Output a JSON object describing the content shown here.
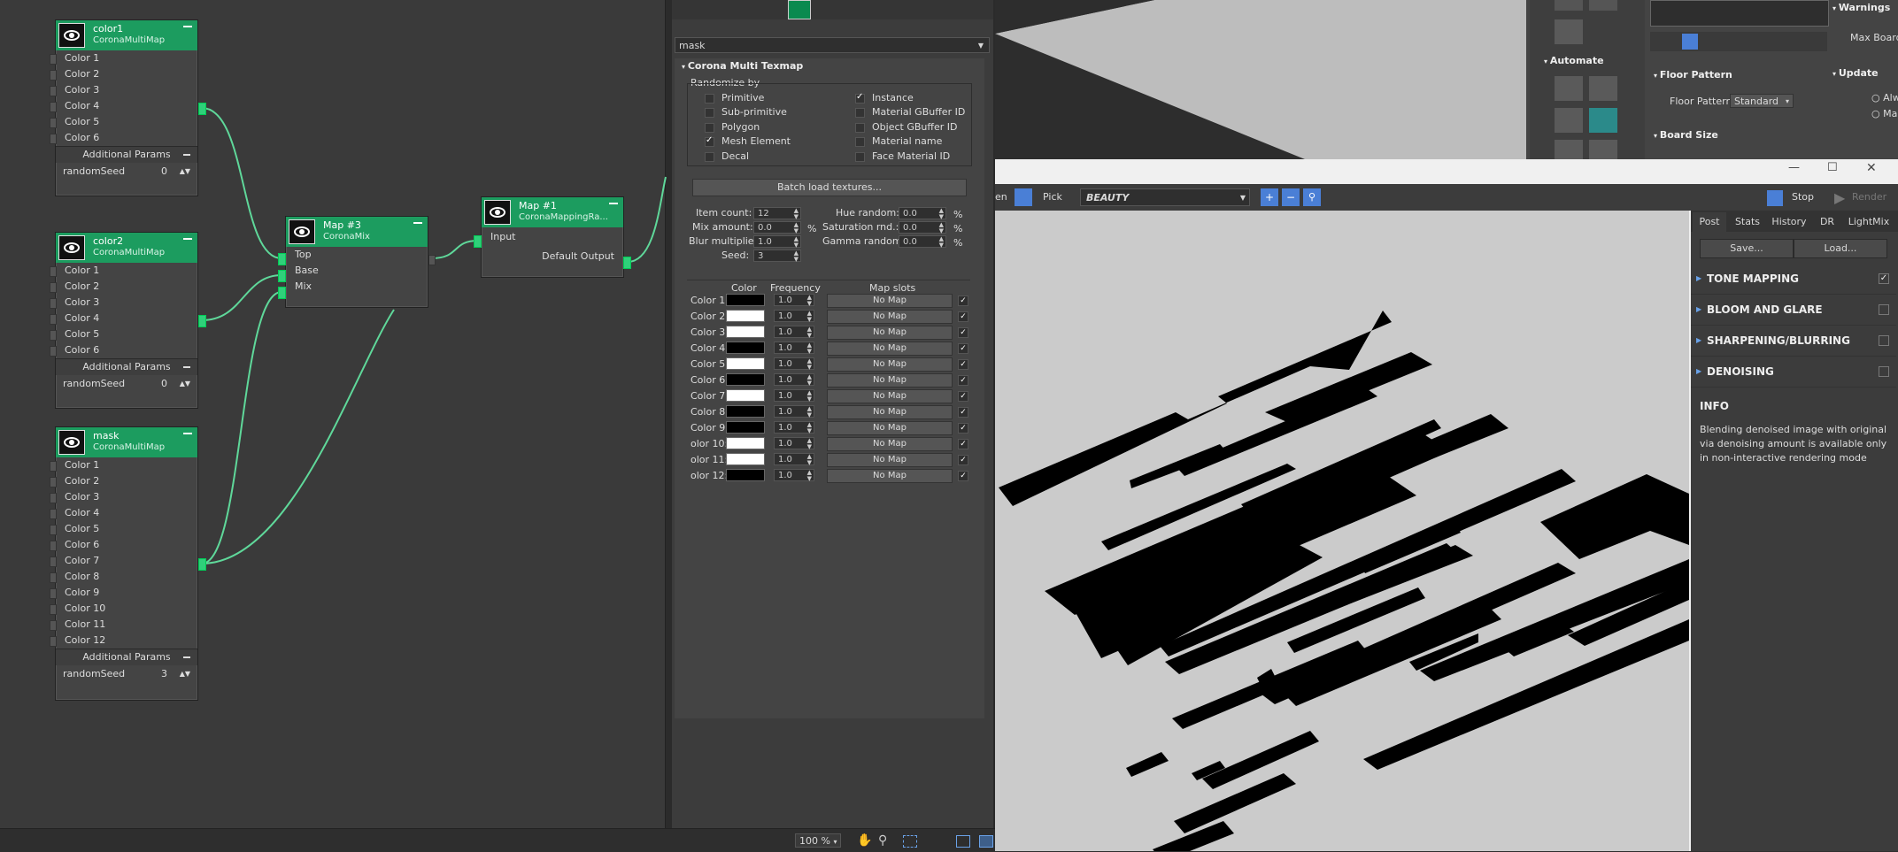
{
  "nodes": {
    "color1": {
      "name": "color1",
      "type": "CoronaMultiMap",
      "slots": [
        "Color 1",
        "Color 2",
        "Color 3",
        "Color 4",
        "Color 5",
        "Color 6"
      ],
      "section": "Additional Params",
      "seed_label": "randomSeed",
      "seed_value": "0"
    },
    "color2": {
      "name": "color2",
      "type": "CoronaMultiMap",
      "slots": [
        "Color 1",
        "Color 2",
        "Color 3",
        "Color 4",
        "Color 5",
        "Color 6"
      ],
      "section": "Additional Params",
      "seed_label": "randomSeed",
      "seed_value": "0"
    },
    "mask": {
      "name": "mask",
      "type": "CoronaMultiMap",
      "slots": [
        "Color 1",
        "Color 2",
        "Color 3",
        "Color 4",
        "Color 5",
        "Color 6",
        "Color 7",
        "Color 8",
        "Color 9",
        "Color 10",
        "Color 11",
        "Color 12"
      ],
      "section": "Additional Params",
      "seed_label": "randomSeed",
      "seed_value": "3"
    },
    "map3": {
      "name": "Map #3",
      "type": "CoronaMix",
      "inputs": [
        "Top",
        "Base",
        "Mix"
      ]
    },
    "map1": {
      "name": "Map #1",
      "type": "CoronaMappingRa...",
      "input": "Input",
      "output": "Default Output"
    }
  },
  "slate_status": {
    "zoom": "100 %"
  },
  "params": {
    "map_name": "mask",
    "rollout_title": "Corona Multi Texmap",
    "randomize_label": "Randomize by",
    "randomize_left": [
      {
        "label": "Primitive",
        "on": false
      },
      {
        "label": "Sub-primitive",
        "on": false
      },
      {
        "label": "Polygon",
        "on": false
      },
      {
        "label": "Mesh Element",
        "on": true
      },
      {
        "label": "Decal",
        "on": false
      }
    ],
    "randomize_right": [
      {
        "label": "Instance",
        "on": true
      },
      {
        "label": "Material GBuffer ID",
        "on": false
      },
      {
        "label": "Object GBuffer ID",
        "on": false
      },
      {
        "label": "Material name",
        "on": false
      },
      {
        "label": "Face Material ID",
        "on": false
      }
    ],
    "batch_button": "Batch load textures...",
    "item_count_label": "Item count:",
    "item_count": "12",
    "mix_amount_label": "Mix amount:",
    "mix_amount": "0.0",
    "mix_unit": "%",
    "blur_label": "Blur multiplier:",
    "blur": "1.0",
    "seed_label": "Seed:",
    "seed": "3",
    "hue_label": "Hue random:",
    "hue": "0.0",
    "hue_unit": "%",
    "sat_label": "Saturation rnd.:",
    "sat": "0.0",
    "sat_unit": "%",
    "gamma_label": "Gamma random:",
    "gamma": "0.0",
    "gamma_unit": "%",
    "col_header_color": "Color",
    "col_header_freq": "Frequency",
    "col_header_slots": "Map slots",
    "rows": [
      {
        "label": "Color 1:",
        "color": "#000000",
        "freq": "1.0",
        "map": "No Map"
      },
      {
        "label": "Color 2:",
        "color": "#ffffff",
        "freq": "1.0",
        "map": "No Map"
      },
      {
        "label": "Color 3:",
        "color": "#ffffff",
        "freq": "1.0",
        "map": "No Map"
      },
      {
        "label": "Color 4:",
        "color": "#000000",
        "freq": "1.0",
        "map": "No Map"
      },
      {
        "label": "Color 5:",
        "color": "#ffffff",
        "freq": "1.0",
        "map": "No Map"
      },
      {
        "label": "Color 6:",
        "color": "#000000",
        "freq": "1.0",
        "map": "No Map"
      },
      {
        "label": "Color 7:",
        "color": "#ffffff",
        "freq": "1.0",
        "map": "No Map"
      },
      {
        "label": "Color 8:",
        "color": "#000000",
        "freq": "1.0",
        "map": "No Map"
      },
      {
        "label": "Color 9:",
        "color": "#000000",
        "freq": "1.0",
        "map": "No Map"
      },
      {
        "label": "olor 10:",
        "color": "#ffffff",
        "freq": "1.0",
        "map": "No Map"
      },
      {
        "label": "olor 11:",
        "color": "#ffffff",
        "freq": "1.0",
        "map": "No Map"
      },
      {
        "label": "olor 12:",
        "color": "#000000",
        "freq": "1.0",
        "map": "No Map"
      }
    ]
  },
  "cmd_panel": {
    "automate": "Automate",
    "warnings": "Warnings",
    "max_boards": "Max Boards",
    "floor_pattern_title": "Floor Pattern",
    "floor_pattern_label": "Floor Pattern",
    "floor_pattern_value": "Standard",
    "board_size": "Board Size",
    "update": "Update",
    "update_opt1": "Alw",
    "update_opt2": "Ma"
  },
  "vfb": {
    "left_fragment": "en",
    "pick": "Pick",
    "channel": "BEAUTY",
    "stop": "Stop",
    "render": "Render",
    "tabs": [
      "Post",
      "Stats",
      "History",
      "DR",
      "LightMix"
    ],
    "save": "Save...",
    "load": "Load...",
    "sections": [
      {
        "label": "TONE MAPPING",
        "checked": true
      },
      {
        "label": "BLOOM AND GLARE",
        "checked": false
      },
      {
        "label": "SHARPENING/BLURRING",
        "checked": false
      },
      {
        "label": "DENOISING",
        "checked": false
      }
    ],
    "info_title": "INFO",
    "info_text": "Blending denoised image with original via denoising amount is available only in non-interactive rendering mode"
  },
  "colors": {
    "node_header": "#1c9c5f",
    "pin": "#2fd07a",
    "wire": "#5fd89a",
    "accent": "#4a7fd6"
  }
}
